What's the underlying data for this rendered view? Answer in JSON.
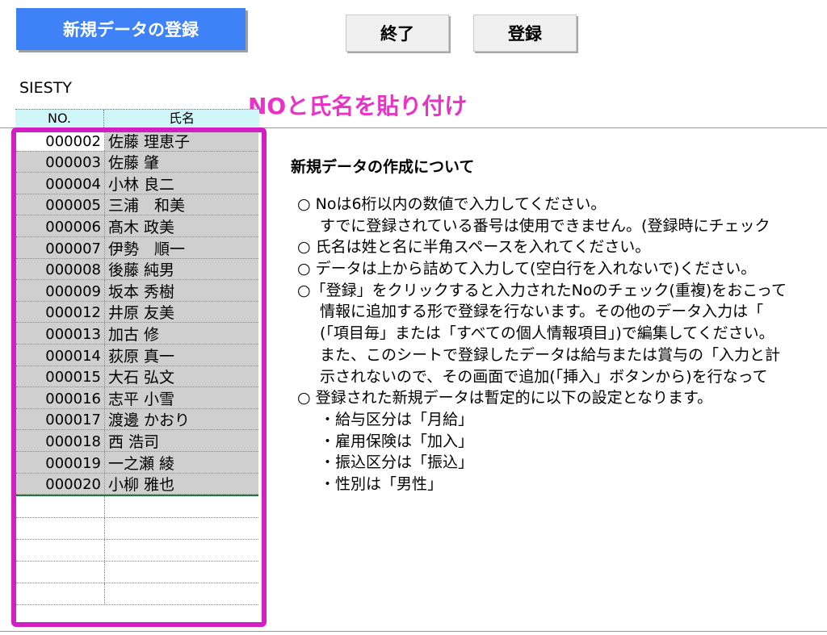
{
  "toolbar": {
    "new_data_button": "新規データの登録",
    "exit_button": "終了",
    "register_button": "登録"
  },
  "company_name": "SIESTY",
  "annotation": "NOと氏名を貼り付け",
  "table": {
    "headers": {
      "no": "NO.",
      "name": "氏名"
    },
    "rows": [
      {
        "no": "000002",
        "name": "佐藤 理恵子"
      },
      {
        "no": "000003",
        "name": "佐藤 肇"
      },
      {
        "no": "000004",
        "name": "小林 良二"
      },
      {
        "no": "000005",
        "name": "三浦　和美"
      },
      {
        "no": "000006",
        "name": "髙木 政美"
      },
      {
        "no": "000007",
        "name": "伊勢　順一"
      },
      {
        "no": "000008",
        "name": "後藤 純男"
      },
      {
        "no": "000009",
        "name": "坂本 秀樹"
      },
      {
        "no": "000012",
        "name": "井原 友美"
      },
      {
        "no": "000013",
        "name": "加古 修"
      },
      {
        "no": "000014",
        "name": "荻原 真一"
      },
      {
        "no": "000015",
        "name": "大石 弘文"
      },
      {
        "no": "000016",
        "name": "志平 小雪"
      },
      {
        "no": "000017",
        "name": "渡邊 かおり"
      },
      {
        "no": "000018",
        "name": "西 浩司"
      },
      {
        "no": "000019",
        "name": "一之瀬 綾"
      },
      {
        "no": "000020",
        "name": "小柳 雅也"
      }
    ]
  },
  "info": {
    "title": "新規データの作成について",
    "lines": [
      "○ Noは6桁以内の数値で入力してください。",
      "すでに登録されている番号は使用できません。(登録時にチェック",
      "○ 氏名は姓と名に半角スペースを入れてください。",
      "○ データは上から詰めて入力して(空白行を入れないで)ください。",
      "○「登録」をクリックすると入力されたNoのチェック(重複)をおこって",
      "情報に追加する形で登録を行ないます。その他のデータ入力は「",
      "(「項目毎」または「すべての個人情報項目」)で編集してください。",
      "また、このシートで登録したデータは給与または賞与の「入力と計",
      "示されないので、その画面で追加(「挿入」ボタンから)を行なって",
      "○ 登録された新規データは暫定的に以下の設定となります。",
      "・給与区分は「月給」",
      "・雇用保険は「加入」",
      "・振込区分は「振込」",
      "・性別は「男性」"
    ]
  }
}
